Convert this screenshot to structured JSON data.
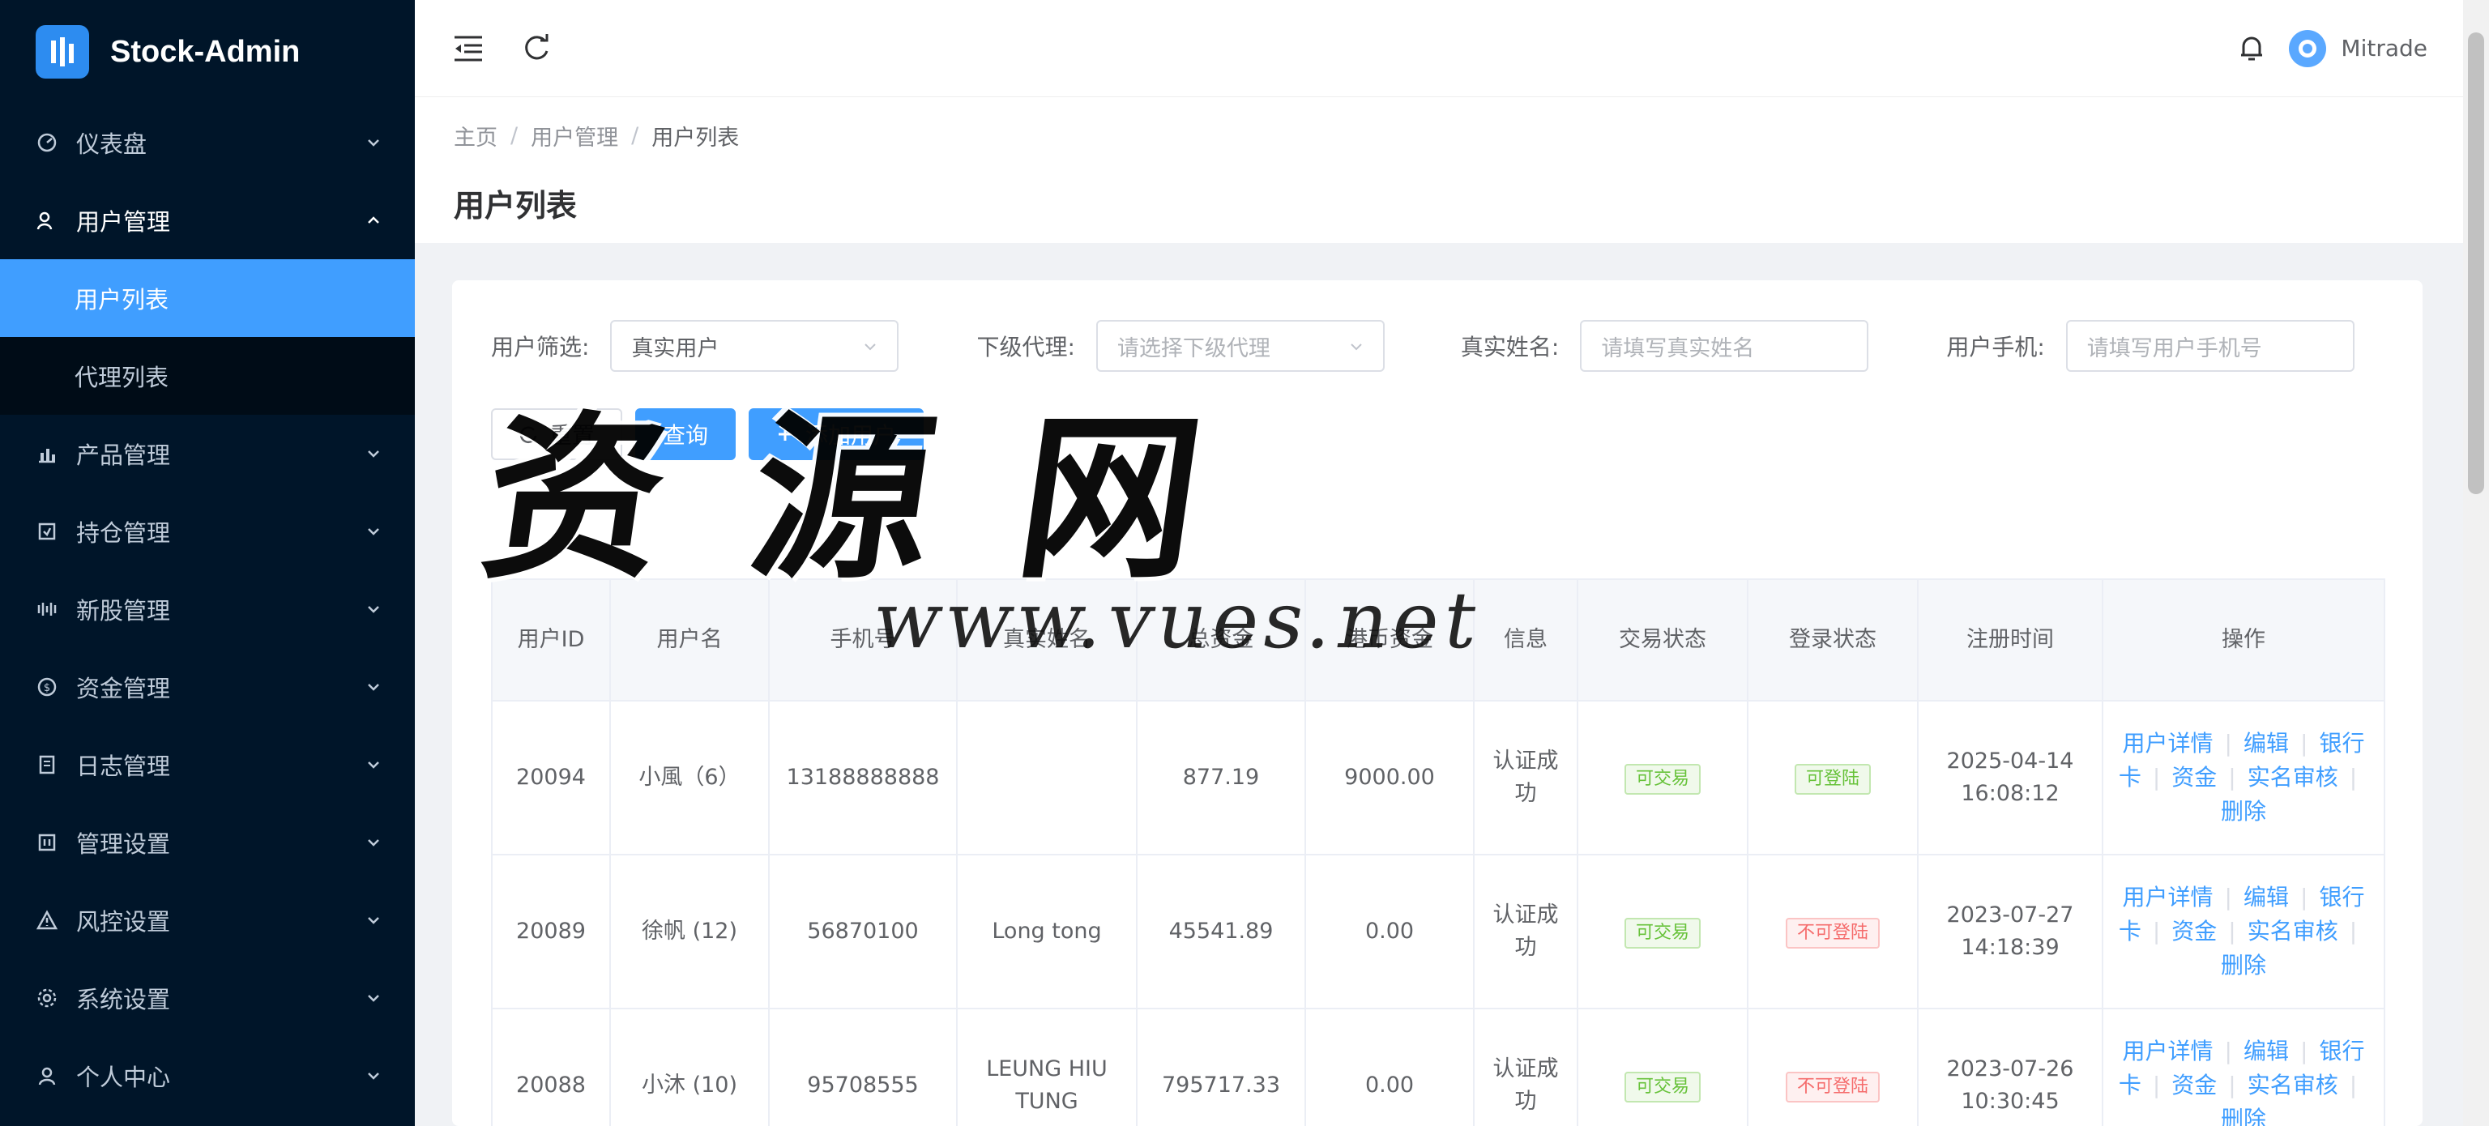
{
  "app": {
    "title": "Stock-Admin"
  },
  "sidebar": {
    "items": [
      {
        "label": "仪表盘",
        "icon": "dashboard-icon"
      },
      {
        "label": "用户管理",
        "icon": "users-icon",
        "open": true,
        "children": [
          {
            "label": "用户列表",
            "active": true
          },
          {
            "label": "代理列表"
          }
        ]
      },
      {
        "label": "产品管理",
        "icon": "chart-icon"
      },
      {
        "label": "持仓管理",
        "icon": "position-icon"
      },
      {
        "label": "新股管理",
        "icon": "ipo-icon"
      },
      {
        "label": "资金管理",
        "icon": "money-icon"
      },
      {
        "label": "日志管理",
        "icon": "log-icon"
      },
      {
        "label": "管理设置",
        "icon": "admin-settings-icon"
      },
      {
        "label": "风控设置",
        "icon": "warning-icon"
      },
      {
        "label": "系统设置",
        "icon": "gear-icon"
      },
      {
        "label": "个人中心",
        "icon": "person-icon"
      }
    ]
  },
  "header": {
    "username": "Mitrade"
  },
  "breadcrumb": {
    "home": "主页",
    "section": "用户管理",
    "current": "用户列表"
  },
  "page": {
    "title": "用户列表"
  },
  "filters": {
    "user_filter": {
      "label": "用户筛选:",
      "value": "真实用户"
    },
    "agent": {
      "label": "下级代理:",
      "placeholder": "请选择下级代理"
    },
    "real_name": {
      "label": "真实姓名:",
      "placeholder": "请填写真实姓名"
    },
    "phone": {
      "label": "用户手机:",
      "placeholder": "请填写用户手机号"
    }
  },
  "buttons": {
    "reset": "重置",
    "query": "查询",
    "add": "添加用户"
  },
  "table": {
    "headers": [
      "用户ID",
      "用户名",
      "手机号",
      "真实姓名",
      "总资金",
      "港币资金",
      "信息",
      "交易状态",
      "登录状态",
      "注册时间",
      "操作"
    ],
    "ops": [
      "用户详情",
      "编辑",
      "银行卡",
      "资金",
      "实名审核",
      "删除"
    ],
    "rows": [
      {
        "id": "20094",
        "name": "小風（6）",
        "phone": "13188888888",
        "real_name": "",
        "total": "877.19",
        "hkd": "9000.00",
        "info": "认证成功",
        "trade": "可交易",
        "login": "可登陆",
        "login_ok": true,
        "date": "2025-04-14",
        "time": "16:08:12"
      },
      {
        "id": "20089",
        "name": "徐帆 (12)",
        "phone": "56870100",
        "real_name": "Long tong",
        "total": "45541.89",
        "hkd": "0.00",
        "info": "认证成功",
        "trade": "可交易",
        "login": "不可登陆",
        "login_ok": false,
        "date": "2023-07-27",
        "time": "14:18:39"
      },
      {
        "id": "20088",
        "name": "小沐 (10)",
        "phone": "95708555",
        "real_name": "LEUNG HIU TUNG",
        "total": "795717.33",
        "hkd": "0.00",
        "info": "认证成功",
        "trade": "可交易",
        "login": "不可登陆",
        "login_ok": false,
        "date": "2023-07-26",
        "time": "10:30:45"
      }
    ]
  },
  "watermark": {
    "big": "资源网",
    "url": "www.vues.net"
  },
  "colors": {
    "sidebar_bg": "#001529",
    "accent": "#409eff",
    "success": "#67c23a",
    "danger": "#f56c6c"
  }
}
